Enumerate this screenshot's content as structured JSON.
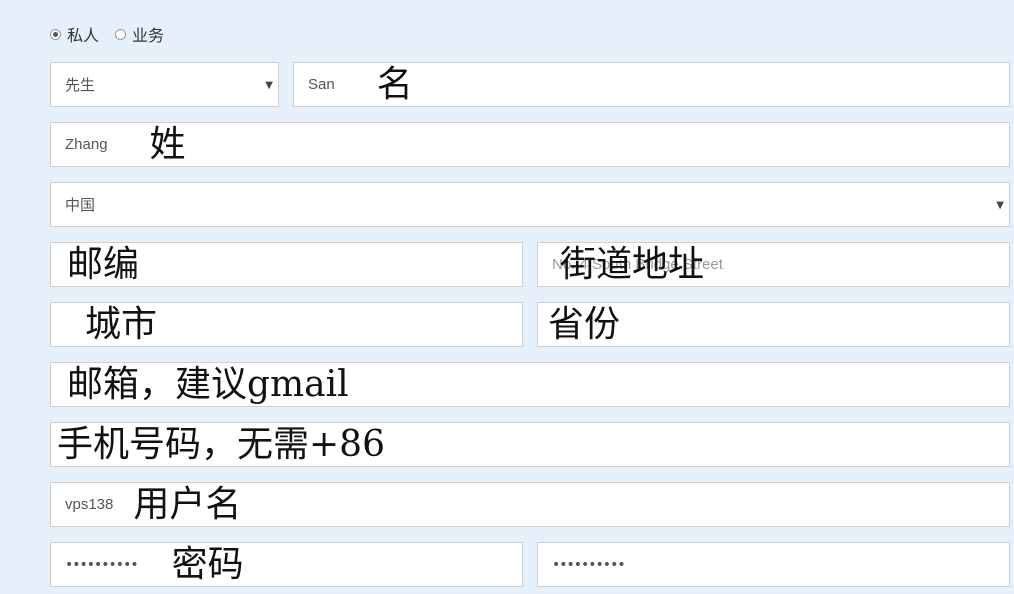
{
  "account_type": {
    "options": [
      "私人",
      "业务"
    ],
    "selected": "私人"
  },
  "salutation": {
    "value": "先生"
  },
  "first_name": {
    "value": "San",
    "annotation": "名"
  },
  "last_name": {
    "value": "Zhang",
    "annotation": "姓"
  },
  "country": {
    "value": "中国"
  },
  "postcode": {
    "annotation": "邮编"
  },
  "street": {
    "value": "No. 4 South Bridge Street",
    "annotation": "街道地址"
  },
  "city": {
    "annotation": "城市"
  },
  "province": {
    "annotation": "省份"
  },
  "email": {
    "annotation": "邮箱，建议gmail"
  },
  "phone": {
    "annotation": "手机号码，无需+86"
  },
  "username": {
    "value": "vps138",
    "annotation": "用户名"
  },
  "password": {
    "value": "••••••••••",
    "annotation": "密码"
  },
  "password_confirm": {
    "value": "••••••••••"
  }
}
